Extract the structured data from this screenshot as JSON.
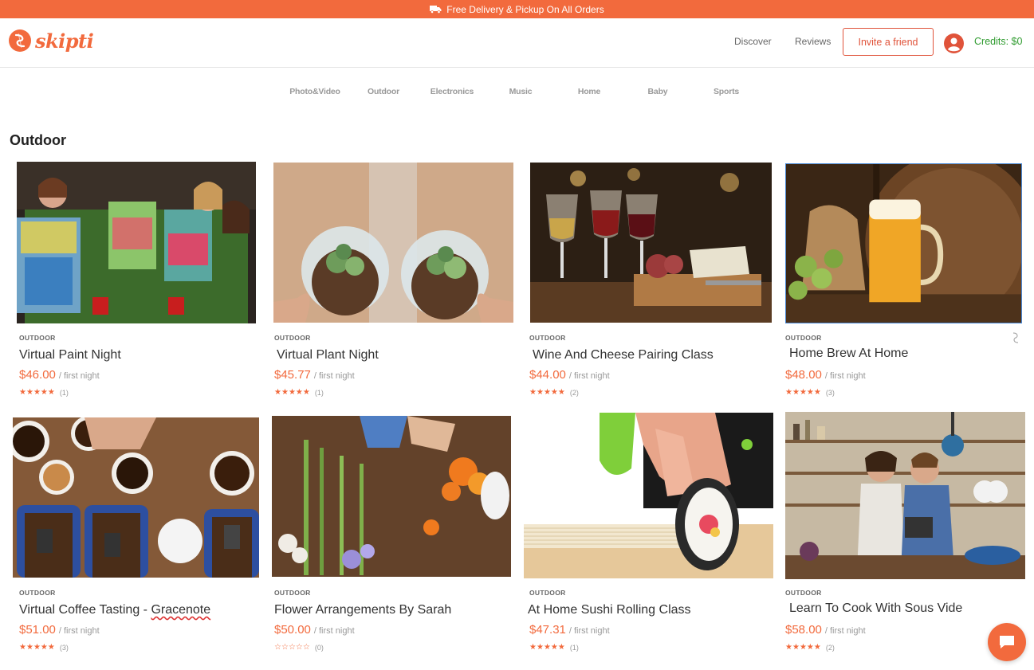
{
  "promo": {
    "text": "Free Delivery & Pickup On All Orders",
    "icon": "truck-icon"
  },
  "header": {
    "logo_text": "skipti",
    "nav": [
      "Discover",
      "Reviews"
    ],
    "invite_label": "Invite a friend",
    "credits": "Credits: $0"
  },
  "categories": [
    "Photo&Video",
    "Outdoor",
    "Electronics",
    "Music",
    "Home",
    "Baby",
    "Sports"
  ],
  "section_title": "Outdoor",
  "colors": {
    "brand": "#f26a3d",
    "credits": "#2e9b2e"
  },
  "cards": [
    {
      "category": "OUTDOOR",
      "title": "Virtual Paint Night",
      "price": "$46.00",
      "per": "/ first night",
      "rating": 5,
      "count": "(1)",
      "image": "people painting on easels"
    },
    {
      "category": "OUTDOOR",
      "title": "Virtual Plant Night",
      "price": "$45.77",
      "per": "/ first night",
      "rating": 5,
      "count": "(1)",
      "image": "terrariums with succulents"
    },
    {
      "category": "OUTDOOR",
      "title": "Wine And Cheese Pairing Class",
      "price": "$44.00",
      "per": "/ first night",
      "rating": 5,
      "count": "(2)",
      "image": "wine glasses and cheese board"
    },
    {
      "category": "OUTDOOR",
      "title": "Home Brew At Home",
      "price": "$48.00",
      "per": "/ first night",
      "rating": 5,
      "count": "(3)",
      "image": "beer mug with hops and barrel"
    },
    {
      "category": "OUTDOOR",
      "title_plain": "Virtual Coffee Tasting - ",
      "title_marked": "Gracenote",
      "price": "$51.00",
      "per": "/ first night",
      "rating": 5,
      "count": "(3)",
      "image": "coffee cups and beans"
    },
    {
      "category": "OUTDOOR",
      "title": "Flower Arrangements By Sarah",
      "price": "$50.00",
      "per": "/ first night",
      "rating": 0,
      "count": "(0)",
      "image": "flower arranging on table"
    },
    {
      "category": "OUTDOOR",
      "title": "At Home Sushi Rolling Class",
      "price": "$47.31",
      "per": "/ first night",
      "rating": 5,
      "count": "(1)",
      "image": "hands rolling sushi"
    },
    {
      "category": "OUTDOOR",
      "title": "Learn To Cook With Sous Vide",
      "price": "$58.00",
      "per": "/ first night",
      "rating": 5,
      "count": "(2)",
      "image": "couple cooking in kitchen"
    }
  ]
}
